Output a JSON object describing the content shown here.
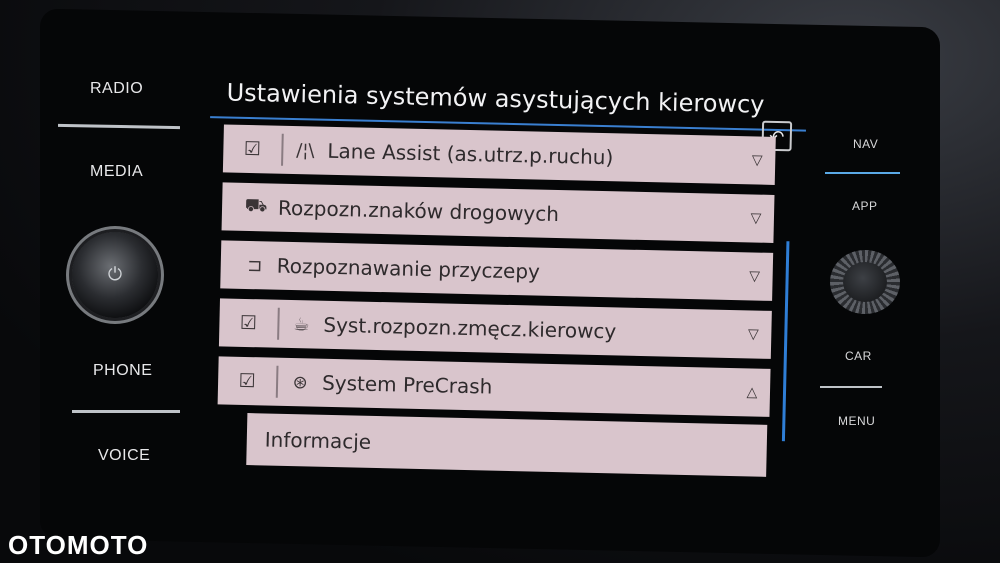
{
  "left_panel": {
    "radio": "RADIO",
    "media": "MEDIA",
    "phone": "PHONE",
    "voice": "VOICE"
  },
  "right_panel": {
    "nav": "NAV",
    "app": "APP",
    "car": "CAR",
    "menu": "MENU"
  },
  "screen": {
    "title": "Ustawienia systemów asystujących kierowcy",
    "back_icon": "back-arrow-icon",
    "accent_color": "#3a7fd0",
    "row_color": "#d9c5cc",
    "items": [
      {
        "label": "Lane Assist (as.utrz.p.ruchu)",
        "checked": true,
        "icon": "lane-assist-icon",
        "expand": "collapsed"
      },
      {
        "label": "Rozpozn.znaków drogowych",
        "checked": null,
        "icon": "traffic-sign-recognition-icon",
        "expand": "collapsed"
      },
      {
        "label": "Rozpoznawanie przyczepy",
        "checked": null,
        "icon": "trailer-icon",
        "expand": "collapsed"
      },
      {
        "label": "Syst.rozpozn.zmęcz.kierowcy",
        "checked": true,
        "icon": "coffee-cup-icon",
        "expand": "collapsed"
      },
      {
        "label": "System PreCrash",
        "checked": true,
        "icon": "precrash-icon",
        "expand": "expanded"
      }
    ],
    "sub_item": "Informacje"
  },
  "watermark": "OTOMOTO"
}
